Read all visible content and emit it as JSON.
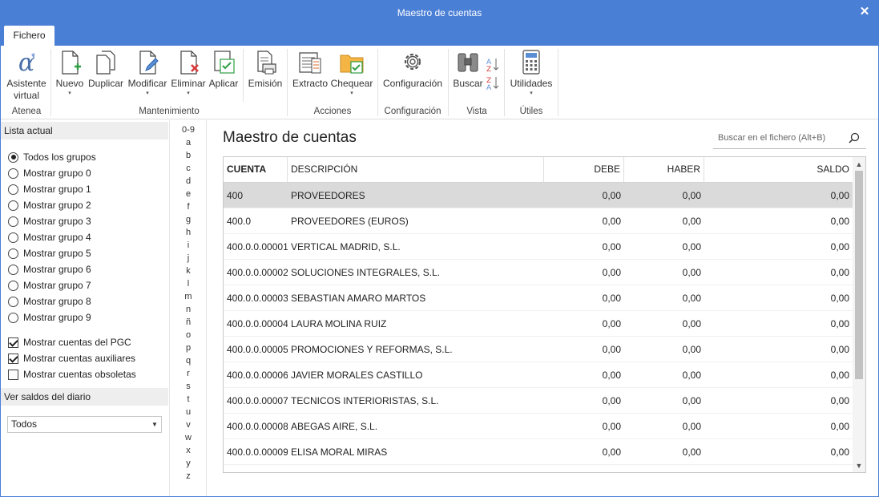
{
  "window": {
    "title": "Maestro de cuentas",
    "close_glyph": "✕"
  },
  "tabs": [
    {
      "label": "Fichero",
      "active": true
    }
  ],
  "ribbon": {
    "buttons": {
      "asistente": {
        "label_line1": "Asistente",
        "label_line2": "virtual",
        "icon": "alpha-icon"
      },
      "nuevo": {
        "label": "Nuevo",
        "icon": "new-document-icon",
        "has_dropdown": true
      },
      "duplicar": {
        "label": "Duplicar",
        "icon": "duplicate-icon"
      },
      "modificar": {
        "label": "Modificar",
        "icon": "edit-document-icon",
        "has_dropdown": true
      },
      "eliminar": {
        "label": "Eliminar",
        "icon": "delete-document-icon",
        "has_dropdown": true
      },
      "aplicar": {
        "label": "Aplicar",
        "icon": "apply-icon"
      },
      "emision": {
        "label": "Emisión",
        "icon": "print-icon"
      },
      "extracto": {
        "label": "Extracto",
        "icon": "ledger-icon"
      },
      "chequear": {
        "label": "Chequear",
        "icon": "folder-check-icon",
        "has_dropdown": true
      },
      "configuracion": {
        "label": "Configuración",
        "icon": "gear-icon"
      },
      "buscar": {
        "label": "Buscar",
        "icon": "binoculars-icon"
      },
      "utilidades": {
        "label": "Utilidades",
        "icon": "calculator-icon",
        "has_dropdown": true
      }
    },
    "groups": {
      "atenea": "Atenea",
      "mantenimiento": "Mantenimiento",
      "acciones": "Acciones",
      "configuracion": "Configuración",
      "vista": "Vista",
      "utiles": "Útiles"
    },
    "caret_glyph": "▾"
  },
  "left_panel": {
    "lista_actual": {
      "header": "Lista actual",
      "radios": [
        {
          "label": "Todos los grupos",
          "checked": true
        },
        {
          "label": "Mostrar grupo 0",
          "checked": false
        },
        {
          "label": "Mostrar grupo 1",
          "checked": false
        },
        {
          "label": "Mostrar grupo 2",
          "checked": false
        },
        {
          "label": "Mostrar grupo 3",
          "checked": false
        },
        {
          "label": "Mostrar grupo 4",
          "checked": false
        },
        {
          "label": "Mostrar grupo 5",
          "checked": false
        },
        {
          "label": "Mostrar grupo 6",
          "checked": false
        },
        {
          "label": "Mostrar grupo 7",
          "checked": false
        },
        {
          "label": "Mostrar grupo 8",
          "checked": false
        },
        {
          "label": "Mostrar grupo 9",
          "checked": false
        }
      ],
      "checks": [
        {
          "label": "Mostrar cuentas del PGC",
          "checked": true
        },
        {
          "label": "Mostrar cuentas auxiliares",
          "checked": true
        },
        {
          "label": "Mostrar cuentas obsoletas",
          "checked": false
        }
      ]
    },
    "saldos": {
      "header": "Ver saldos del diario",
      "select_value": "Todos",
      "select_arrow": "▼"
    }
  },
  "alpha_index": [
    "0-9",
    "a",
    "b",
    "c",
    "d",
    "e",
    "f",
    "g",
    "h",
    "i",
    "j",
    "k",
    "l",
    "m",
    "n",
    "ñ",
    "o",
    "p",
    "q",
    "r",
    "s",
    "t",
    "u",
    "v",
    "w",
    "x",
    "y",
    "z"
  ],
  "main": {
    "title": "Maestro de cuentas",
    "search_placeholder": "Buscar en el fichero (Alt+B)"
  },
  "table": {
    "columns": [
      "CUENTA",
      "DESCRIPCIÓN",
      "DEBE",
      "HABER",
      "SALDO"
    ],
    "rows": [
      {
        "cuenta": "400",
        "descripcion": "PROVEEDORES",
        "debe": "0,00",
        "haber": "0,00",
        "saldo": "0,00",
        "selected": true
      },
      {
        "cuenta": "400.0",
        "descripcion": "PROVEEDORES (EUROS)",
        "debe": "0,00",
        "haber": "0,00",
        "saldo": "0,00"
      },
      {
        "cuenta": "400.0.0.00001",
        "descripcion": "VERTICAL MADRID, S.L.",
        "debe": "0,00",
        "haber": "0,00",
        "saldo": "0,00"
      },
      {
        "cuenta": "400.0.0.00002",
        "descripcion": "SOLUCIONES INTEGRALES, S.L.",
        "debe": "0,00",
        "haber": "0,00",
        "saldo": "0,00"
      },
      {
        "cuenta": "400.0.0.00003",
        "descripcion": "SEBASTIAN AMARO MARTOS",
        "debe": "0,00",
        "haber": "0,00",
        "saldo": "0,00"
      },
      {
        "cuenta": "400.0.0.00004",
        "descripcion": "LAURA MOLINA RUIZ",
        "debe": "0,00",
        "haber": "0,00",
        "saldo": "0,00"
      },
      {
        "cuenta": "400.0.0.00005",
        "descripcion": "PROMOCIONES Y REFORMAS, S.L.",
        "debe": "0,00",
        "haber": "0,00",
        "saldo": "0,00"
      },
      {
        "cuenta": "400.0.0.00006",
        "descripcion": "JAVIER MORALES CASTILLO",
        "debe": "0,00",
        "haber": "0,00",
        "saldo": "0,00"
      },
      {
        "cuenta": "400.0.0.00007",
        "descripcion": "TECNICOS INTERIORISTAS, S.L.",
        "debe": "0,00",
        "haber": "0,00",
        "saldo": "0,00"
      },
      {
        "cuenta": "400.0.0.00008",
        "descripcion": "ABEGAS AIRE, S.L.",
        "debe": "0,00",
        "haber": "0,00",
        "saldo": "0,00"
      },
      {
        "cuenta": "400.0.0.00009",
        "descripcion": "ELISA MORAL MIRAS",
        "debe": "0,00",
        "haber": "0,00",
        "saldo": "0,00"
      }
    ],
    "scroll_up_glyph": "▲",
    "scroll_down_glyph": "▼"
  },
  "colors": {
    "titlebar": "#4a7fd6",
    "selected_row": "#dadada",
    "accent_green": "#2e9e44",
    "accent_red": "#d83b3b"
  }
}
